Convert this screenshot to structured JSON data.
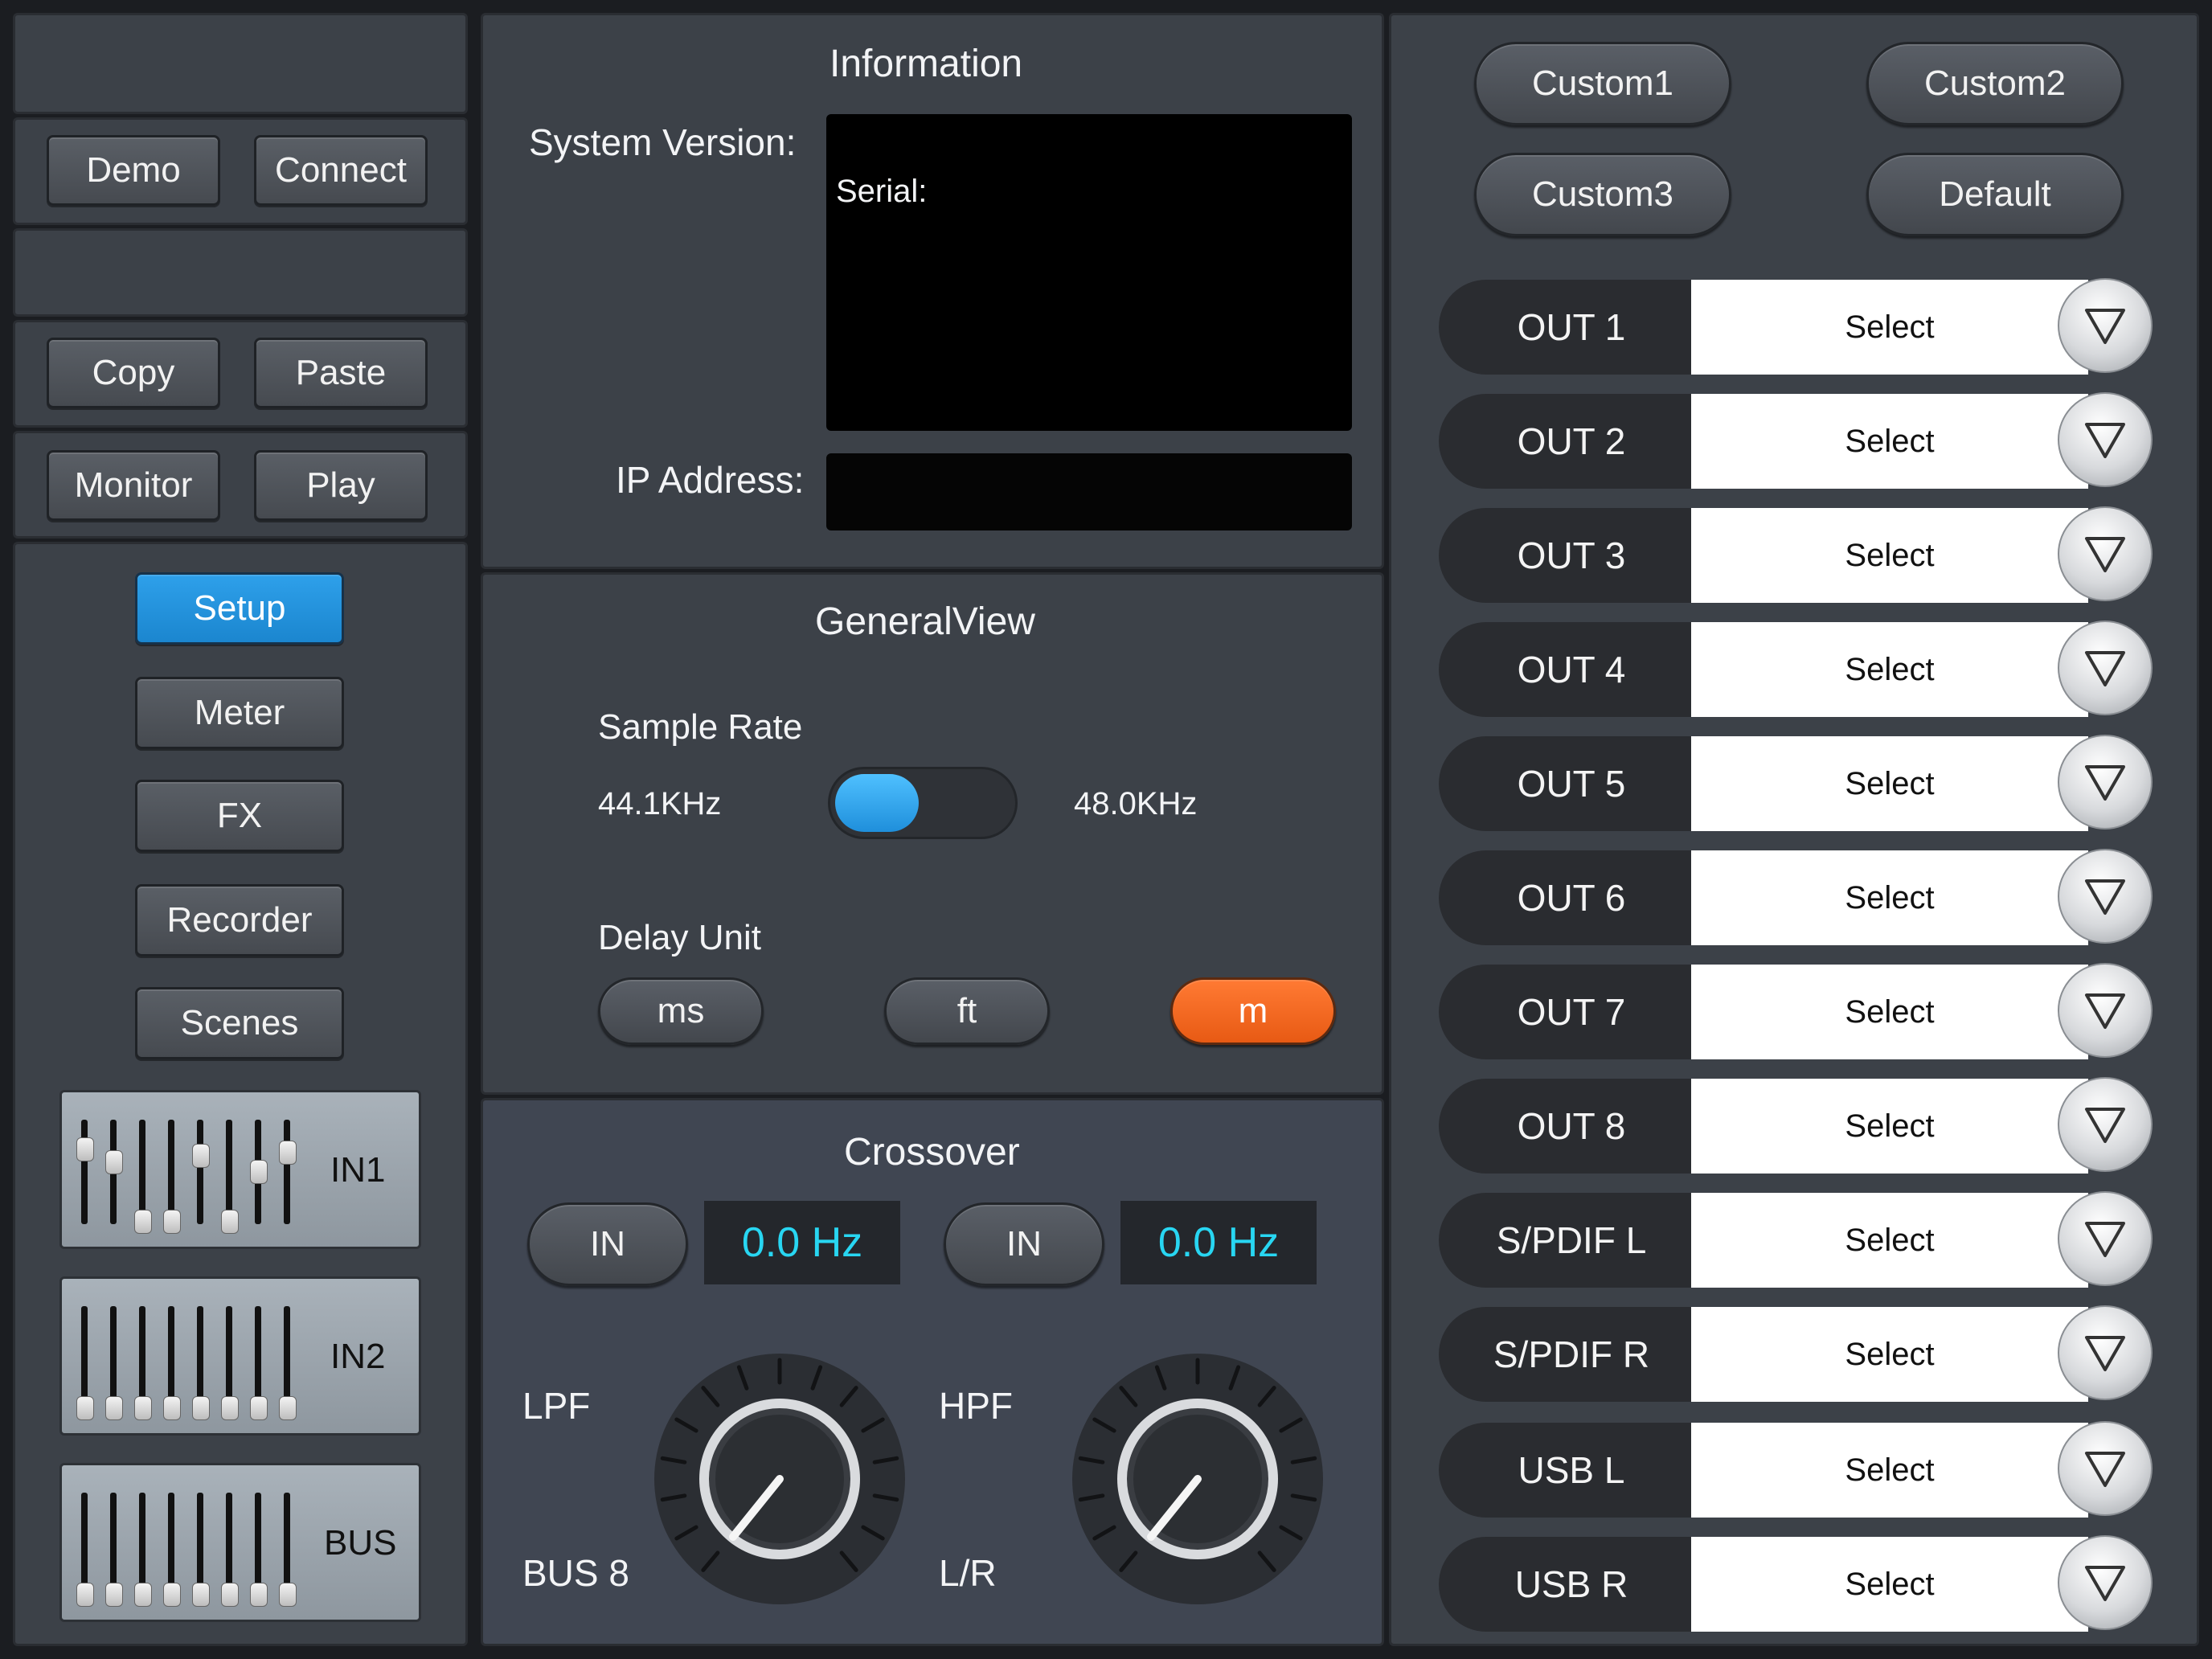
{
  "left": {
    "demo": "Demo",
    "connect": "Connect",
    "copy": "Copy",
    "paste": "Paste",
    "monitor": "Monitor",
    "play": "Play",
    "nav": [
      "Setup",
      "Meter",
      "FX",
      "Recorder",
      "Scenes"
    ],
    "active_nav": "Setup",
    "strips": [
      "IN1",
      "IN2",
      "BUS"
    ]
  },
  "information": {
    "title": "Information",
    "system_version_label": "System Version:",
    "serial_label": "Serial:",
    "ip_label": "IP Address:"
  },
  "general": {
    "title": "GeneralView",
    "sample_rate_label": "Sample Rate",
    "rate_left": "44.1KHz",
    "rate_right": "48.0KHz",
    "delay_unit_label": "Delay Unit",
    "units": [
      "ms",
      "ft",
      "m"
    ],
    "active_unit": "m"
  },
  "crossover": {
    "title": "Crossover",
    "in1": "IN",
    "freq1": "0.0 Hz",
    "in2": "IN",
    "freq2": "0.0 Hz",
    "lpf": "LPF",
    "bus8": "BUS 8",
    "hpf": "HPF",
    "lr": "L/R"
  },
  "presets": [
    "Custom1",
    "Custom2",
    "Custom3",
    "Default"
  ],
  "outputs": [
    {
      "name": "OUT 1",
      "value": "Select"
    },
    {
      "name": "OUT 2",
      "value": "Select"
    },
    {
      "name": "OUT 3",
      "value": "Select"
    },
    {
      "name": "OUT 4",
      "value": "Select"
    },
    {
      "name": "OUT 5",
      "value": "Select"
    },
    {
      "name": "OUT 6",
      "value": "Select"
    },
    {
      "name": "OUT 7",
      "value": "Select"
    },
    {
      "name": "OUT 8",
      "value": "Select"
    },
    {
      "name": "S/PDIF L",
      "value": "Select"
    },
    {
      "name": "S/PDIF R",
      "value": "Select"
    },
    {
      "name": "USB L",
      "value": "Select"
    },
    {
      "name": "USB R",
      "value": "Select"
    }
  ],
  "colors": {
    "accent_blue": "#1f8fdb",
    "accent_orange": "#f26a21",
    "readout_cyan": "#28d6f2"
  }
}
